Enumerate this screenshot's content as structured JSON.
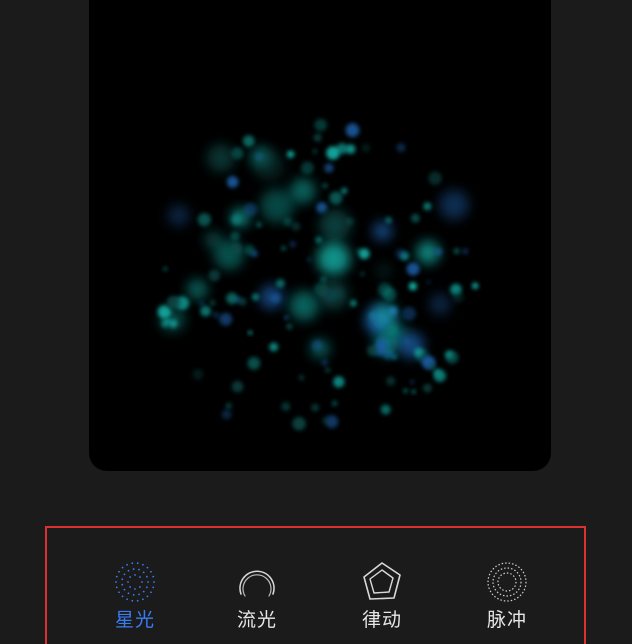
{
  "preview": {
    "particle_colors": [
      "#13b4aa",
      "#0f8f88",
      "#1d5fa8",
      "#0a4a46"
    ]
  },
  "styles": {
    "selected_index": 0,
    "accent_color": "#3a7cf5",
    "items": [
      {
        "label": "星光",
        "icon": "starlight-dots-icon"
      },
      {
        "label": "流光",
        "icon": "flowing-arc-icon"
      },
      {
        "label": "律动",
        "icon": "rhythm-pentagon-icon"
      },
      {
        "label": "脉冲",
        "icon": "pulse-rings-icon"
      }
    ]
  }
}
